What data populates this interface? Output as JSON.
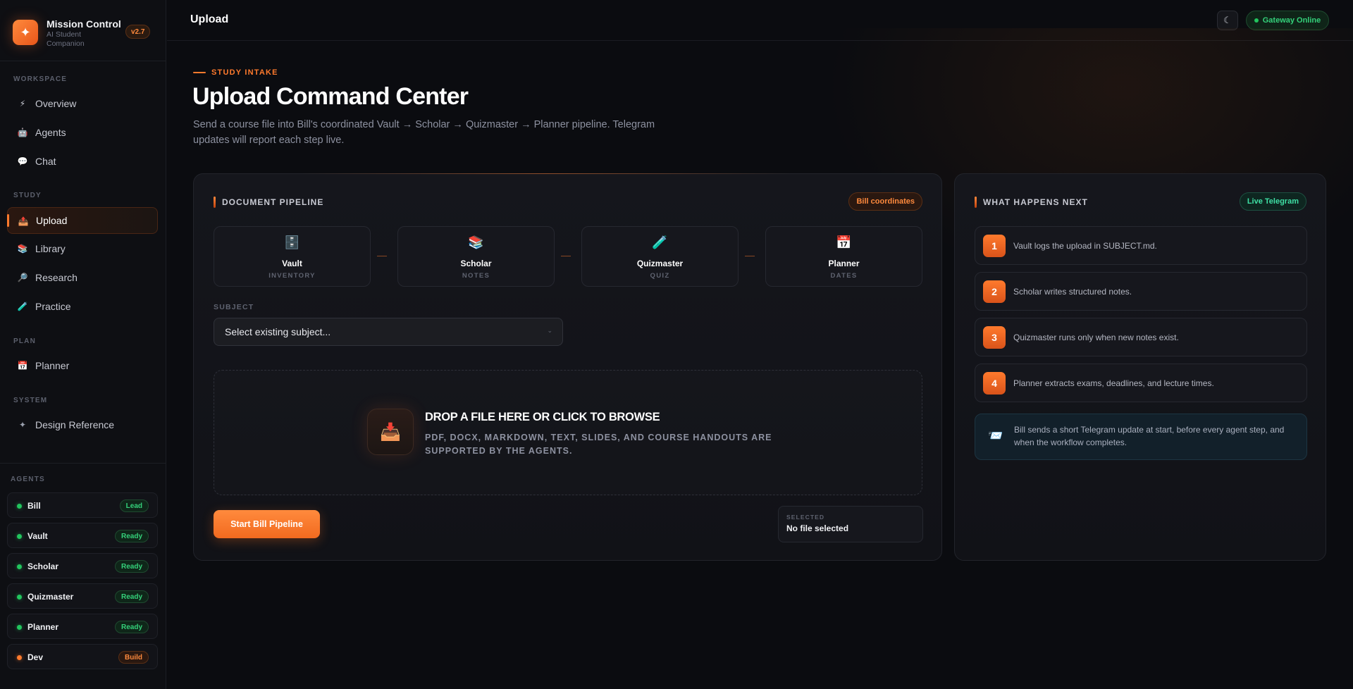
{
  "brand": {
    "title": "Mission Control",
    "subtitle": "AI Student Companion",
    "version": "v2.7",
    "logo_icon": "✦"
  },
  "sidebar": {
    "sections": {
      "workspace": "WORKSPACE",
      "study": "STUDY",
      "plan": "PLAN",
      "system": "SYSTEM",
      "agents": "AGENTS"
    },
    "items": [
      {
        "label": "Overview",
        "icon": "⚡"
      },
      {
        "label": "Agents",
        "icon": "🤖"
      },
      {
        "label": "Chat",
        "icon": "💬"
      },
      {
        "label": "Upload",
        "icon": "📤"
      },
      {
        "label": "Library",
        "icon": "📚"
      },
      {
        "label": "Research",
        "icon": "🔎"
      },
      {
        "label": "Practice",
        "icon": "🧪"
      },
      {
        "label": "Planner",
        "icon": "📅"
      },
      {
        "label": "Design Reference",
        "icon": "✦"
      }
    ],
    "agents": [
      {
        "name": "Bill",
        "status": "Lead"
      },
      {
        "name": "Vault",
        "status": "Ready"
      },
      {
        "name": "Scholar",
        "status": "Ready"
      },
      {
        "name": "Quizmaster",
        "status": "Ready"
      },
      {
        "name": "Planner",
        "status": "Ready"
      },
      {
        "name": "Dev",
        "status": "Build"
      }
    ]
  },
  "topbar": {
    "title": "Upload",
    "theme_icon": "☾",
    "gateway_status": "Gateway Online"
  },
  "hero": {
    "eyebrow": "STUDY INTAKE",
    "title": "Upload Command Center",
    "description": "Send a course file into Bill's coordinated Vault → Scholar → Quizmaster → Planner pipeline. Telegram updates will report each step live."
  },
  "pipeline": {
    "heading": "DOCUMENT PIPELINE",
    "badge": "Bill coordinates",
    "stages": [
      {
        "name": "Vault",
        "sub": "INVENTORY",
        "icon": "🗄️"
      },
      {
        "name": "Scholar",
        "sub": "NOTES",
        "icon": "📚"
      },
      {
        "name": "Quizmaster",
        "sub": "QUIZ",
        "icon": "🧪"
      },
      {
        "name": "Planner",
        "sub": "DATES",
        "icon": "📅"
      }
    ],
    "subject_label": "SUBJECT",
    "subject_value": "Select existing subject...",
    "dropzone_title": "DROP A FILE HERE OR CLICK TO BROWSE",
    "dropzone_sub": "PDF, DOCX, MARKDOWN, TEXT, SLIDES, AND COURSE HANDOUTS ARE SUPPORTED BY THE AGENTS.",
    "dropzone_icon": "📥",
    "start_label": "Start Bill Pipeline",
    "selected_label": "SELECTED",
    "selected_value": "No file selected"
  },
  "next": {
    "heading": "WHAT HAPPENS NEXT",
    "badge": "Live Telegram",
    "steps": [
      {
        "num": "1",
        "text": "Vault logs the upload in SUBJECT.md."
      },
      {
        "num": "2",
        "text": "Scholar writes structured notes."
      },
      {
        "num": "3",
        "text": "Quizmaster runs only when new notes exist."
      },
      {
        "num": "4",
        "text": "Planner extracts exams, deadlines, and lecture times."
      }
    ],
    "telegram_icon": "📨",
    "telegram_note": "Bill sends a short Telegram update at start, before every agent step, and when the workflow completes."
  },
  "colors": {
    "accent": "#ff7a2d",
    "success": "#22c55e",
    "background": "#0b0c10"
  }
}
